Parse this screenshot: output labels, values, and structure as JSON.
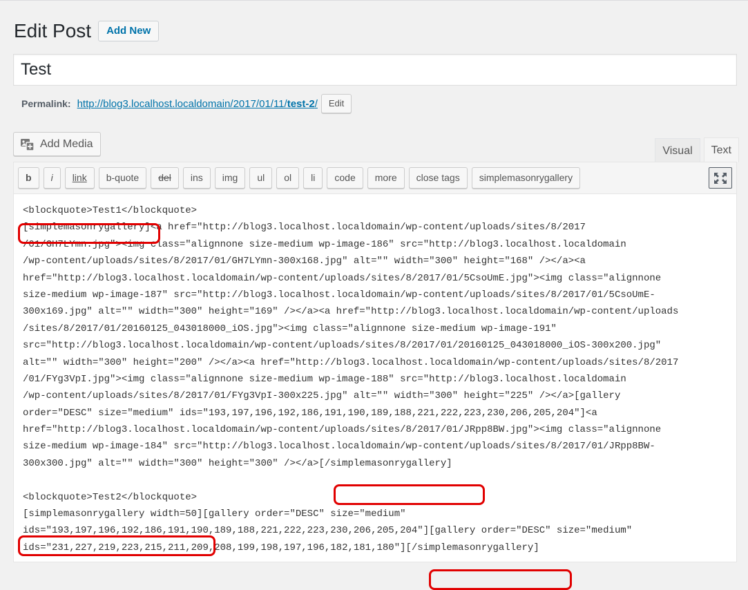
{
  "header": {
    "title": "Edit Post",
    "add_new": "Add New"
  },
  "post": {
    "title": "Test"
  },
  "permalink": {
    "label": "Permalink:",
    "url_base": "http://blog3.localhost.localdomain/2017/01/11/",
    "url_slug": "test-2",
    "url_tail": "/",
    "edit_label": "Edit"
  },
  "media": {
    "add_media": "Add Media"
  },
  "tabs": {
    "visual": "Visual",
    "text": "Text",
    "active": "Text"
  },
  "toolbar": {
    "buttons": [
      "b",
      "i",
      "link",
      "b-quote",
      "del",
      "ins",
      "img",
      "ul",
      "ol",
      "li",
      "code",
      "more",
      "close tags",
      "simplemasonrygallery"
    ]
  },
  "content": {
    "lines": [
      "<blockquote>Test1</blockquote>",
      "[simplemasonrygallery]<a href=\"http://blog3.localhost.localdomain/wp-content/uploads/sites/8/2017",
      "/01/GH7LYmn.jpg\"><img class=\"alignnone size-medium wp-image-186\" src=\"http://blog3.localhost.localdomain",
      "/wp-content/uploads/sites/8/2017/01/GH7LYmn-300x168.jpg\" alt=\"\" width=\"300\" height=\"168\" /></a><a",
      "href=\"http://blog3.localhost.localdomain/wp-content/uploads/sites/8/2017/01/5CsoUmE.jpg\"><img class=\"alignnone",
      "size-medium wp-image-187\" src=\"http://blog3.localhost.localdomain/wp-content/uploads/sites/8/2017/01/5CsoUmE-",
      "300x169.jpg\" alt=\"\" width=\"300\" height=\"169\" /></a><a href=\"http://blog3.localhost.localdomain/wp-content/uploads",
      "/sites/8/2017/01/20160125_043018000_iOS.jpg\"><img class=\"alignnone size-medium wp-image-191\"",
      "src=\"http://blog3.localhost.localdomain/wp-content/uploads/sites/8/2017/01/20160125_043018000_iOS-300x200.jpg\"",
      "alt=\"\" width=\"300\" height=\"200\" /></a><a href=\"http://blog3.localhost.localdomain/wp-content/uploads/sites/8/2017",
      "/01/FYg3VpI.jpg\"><img class=\"alignnone size-medium wp-image-188\" src=\"http://blog3.localhost.localdomain",
      "/wp-content/uploads/sites/8/2017/01/FYg3VpI-300x225.jpg\" alt=\"\" width=\"300\" height=\"225\" /></a>[gallery",
      "order=\"DESC\" size=\"medium\" ids=\"193,197,196,192,186,191,190,189,188,221,222,223,230,206,205,204\"]<a",
      "href=\"http://blog3.localhost.localdomain/wp-content/uploads/sites/8/2017/01/JRpp8BW.jpg\"><img class=\"alignnone",
      "size-medium wp-image-184\" src=\"http://blog3.localhost.localdomain/wp-content/uploads/sites/8/2017/01/JRpp8BW-",
      "300x300.jpg\" alt=\"\" width=\"300\" height=\"300\" /></a>[/simplemasonrygallery]",
      "",
      "<blockquote>Test2</blockquote>",
      "[simplemasonrygallery width=50][gallery order=\"DESC\" size=\"medium\"",
      "ids=\"193,197,196,192,186,191,190,189,188,221,222,223,230,206,205,204\"][gallery order=\"DESC\" size=\"medium\"",
      "ids=\"231,227,219,223,215,211,209,208,199,198,197,196,182,181,180\"][/simplemasonrygallery]"
    ]
  },
  "colors": {
    "highlight": "#e10000",
    "link": "#0073aa"
  }
}
